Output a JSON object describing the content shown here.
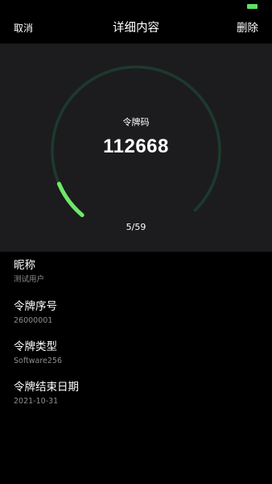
{
  "status_bar": {
    "battery_color": "#5ee062"
  },
  "nav": {
    "cancel_label": "取消",
    "title": "详细内容",
    "delete_label": "删除"
  },
  "token": {
    "label": "令牌码",
    "code": "112668",
    "counter": "5/59",
    "progress_fraction": 0.0847,
    "ring_track_color": "#1d3a2c",
    "ring_progress_color": "#6fe868",
    "panel_color": "#1c1c1e"
  },
  "details": [
    {
      "label": "昵称",
      "value": "测试用户"
    },
    {
      "label": "令牌序号",
      "value": "26000001"
    },
    {
      "label": "令牌类型",
      "value": "Software256"
    },
    {
      "label": "令牌结束日期",
      "value": "2021-10-31"
    }
  ]
}
